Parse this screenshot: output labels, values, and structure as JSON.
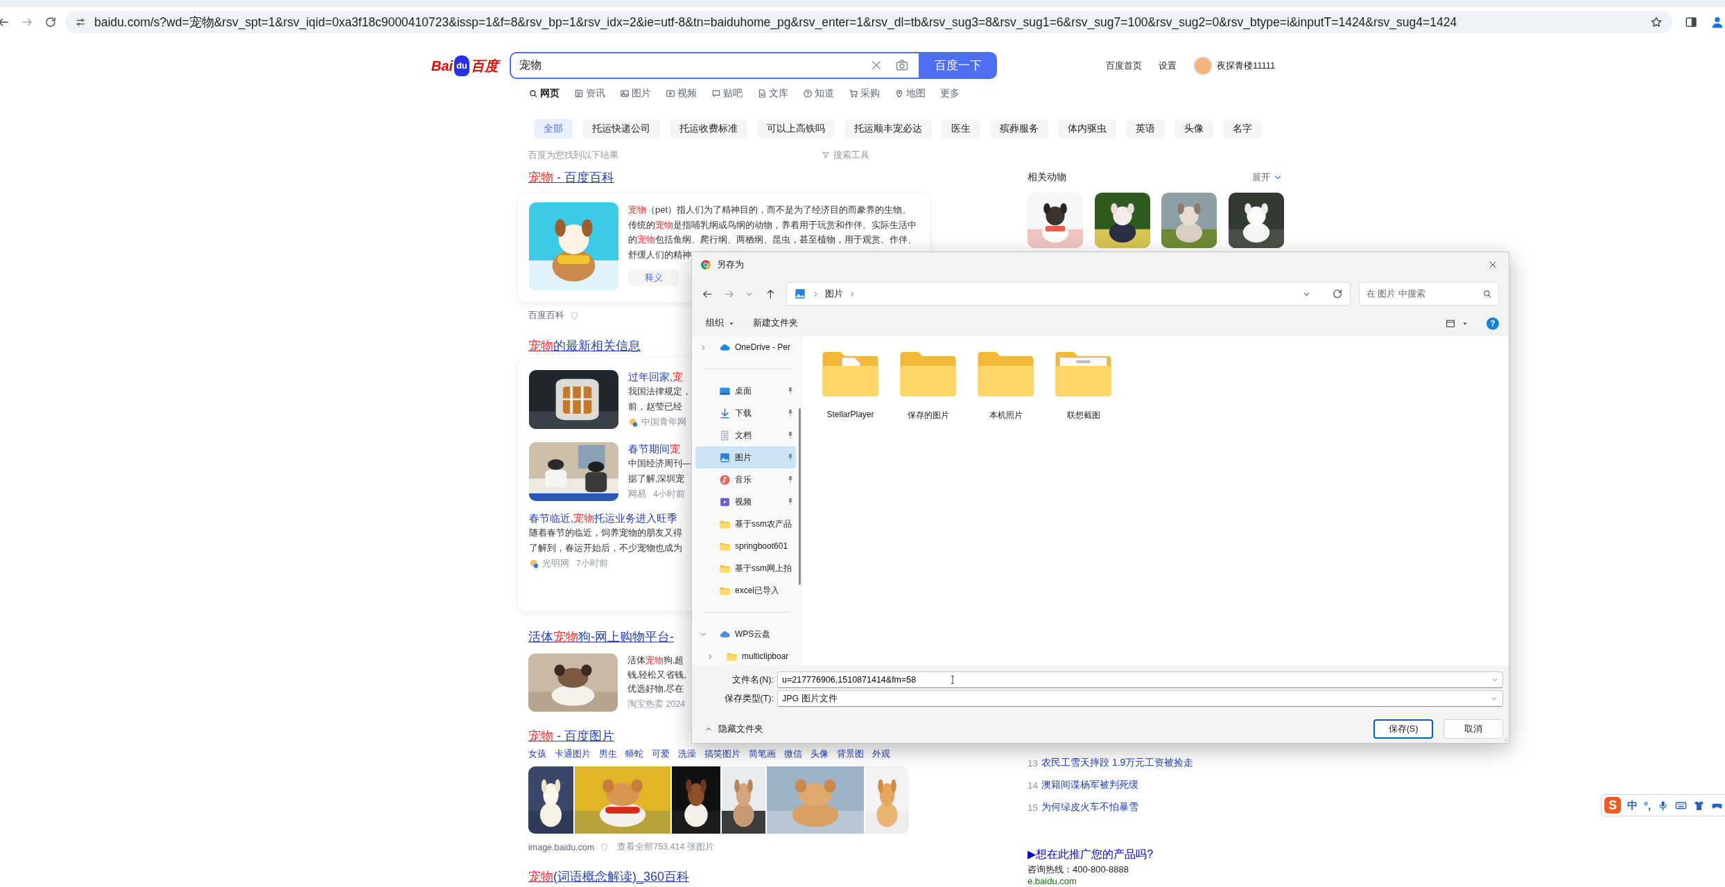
{
  "browser": {
    "url": "baidu.com/s?wd=宠物&rsv_spt=1&rsv_iqid=0xa3f18c9000410723&issp=1&f=8&rsv_bp=1&rsv_idx=2&ie=utf-8&tn=baiduhome_pg&rsv_enter=1&rsv_dl=tb&rsv_sug3=8&rsv_sug1=6&rsv_sug7=100&rsv_sug2=0&rsv_btype=i&inputT=1424&rsv_sug4=1424"
  },
  "header": {
    "logo": {
      "left": "Bai",
      "paw": "du",
      "right": "百度"
    },
    "search": {
      "value": "宠物"
    },
    "search_button": "百度一下",
    "links": [
      "百度首页",
      "设置"
    ],
    "user": "夜探青楼11111"
  },
  "tabs": [
    {
      "label": "网页",
      "selected": true
    },
    {
      "label": "资讯",
      "selected": false
    },
    {
      "label": "图片",
      "selected": false
    },
    {
      "label": "视频",
      "selected": false
    },
    {
      "label": "贴吧",
      "selected": false
    },
    {
      "label": "文库",
      "selected": false
    },
    {
      "label": "知道",
      "selected": false
    },
    {
      "label": "采购",
      "selected": false
    },
    {
      "label": "地图",
      "selected": false
    },
    {
      "label": "更多",
      "selected": false
    }
  ],
  "chips": [
    {
      "label": "全部",
      "selected": true
    },
    {
      "label": "托运快递公司",
      "selected": false
    },
    {
      "label": "托运收费标准",
      "selected": false
    },
    {
      "label": "可以上高铁吗",
      "selected": false
    },
    {
      "label": "托运顺丰宠必达",
      "selected": false
    },
    {
      "label": "医生",
      "selected": false
    },
    {
      "label": "殡葬服务",
      "selected": false
    },
    {
      "label": "体内驱虫",
      "selected": false
    },
    {
      "label": "英语",
      "selected": false
    },
    {
      "label": "头像",
      "selected": false
    },
    {
      "label": "名字",
      "selected": false
    }
  ],
  "result_count": "百度为您找到以下结果",
  "search_tools": "搜索工具",
  "results": [
    {
      "kind": "baike",
      "title": [
        {
          "t": "宠物",
          "hit": true
        },
        {
          "t": " - 百度百科",
          "hit": false
        }
      ],
      "lines": [
        [
          {
            "t": "宠物",
            "hit": true
          },
          {
            "t": "（pet）指人们为了精神目的，而不是为了经济目的而豢养的生物。",
            "hit": false
          }
        ],
        [
          {
            "t": "传统的",
            "hit": false
          },
          {
            "t": "宠物",
            "hit": true
          },
          {
            "t": "是指哺乳纲或鸟纲的动物，养着用于玩赏和作伴。实际生活中",
            "hit": false
          }
        ],
        [
          {
            "t": "的",
            "hit": false
          },
          {
            "t": "宠物",
            "hit": true
          },
          {
            "t": "包括鱼纲、爬行纲、两栖纲、昆虫，甚至植物，用于观赏、作伴、",
            "hit": false
          }
        ],
        [
          {
            "t": "舒缓人们的精神",
            "hit": false
          }
        ]
      ],
      "button": "释义",
      "source": "百度百科"
    },
    {
      "kind": "news",
      "title": [
        {
          "t": "宠物",
          "hit": true
        },
        {
          "t": "的最新相关信息",
          "hit": false
        }
      ],
      "items": [
        {
          "kind": "with_image",
          "title": [
            {
              "t": "过年回家,",
              "hit": false
            },
            {
              "t": "宠",
              "hit": true
            }
          ],
          "lines": [
            "我国法律规定，",
            "前，赵莹已经"
          ],
          "source": "中国青年网",
          "source_logo": true
        },
        {
          "kind": "with_image",
          "title": [
            {
              "t": "春节期间",
              "hit": false
            },
            {
              "t": "宠",
              "hit": true
            }
          ],
          "lines": [
            "中国经济周刊—",
            "据了解,深圳宠"
          ],
          "source": "网易",
          "time": "4小时前",
          "source_logo": false
        },
        {
          "kind": "text",
          "title": [
            {
              "t": "春节临近,",
              "hit": false
            },
            {
              "t": "宠物",
              "hit": true
            },
            {
              "t": "托运业务进入旺季",
              "hit": false
            }
          ],
          "lines": [
            "随着春节的临近，饲养宠物的朋友又得",
            "了解到，春运开始后，不少宠物也成为"
          ],
          "source": "光明网",
          "time": "7小时前",
          "source_logo": true
        }
      ]
    },
    {
      "kind": "shop",
      "title": [
        {
          "t": "活体",
          "hit": false
        },
        {
          "t": "宠物",
          "hit": true
        },
        {
          "t": "狗-网上购物平台-",
          "hit": false
        }
      ],
      "lines": [
        [
          {
            "t": "活体",
            "hit": false
          },
          {
            "t": "宠物",
            "hit": true
          },
          {
            "t": "狗,超",
            "hit": false
          }
        ],
        [
          {
            "t": "钱,轻松又省钱,",
            "hit": false
          }
        ],
        [
          {
            "t": "优选好物,尽在",
            "hit": false
          }
        ]
      ],
      "source": "淘宝热卖 2024"
    },
    {
      "kind": "images",
      "title": [
        {
          "t": "宠物",
          "hit": true
        },
        {
          "t": " - 百度图片",
          "hit": false
        }
      ],
      "tags": [
        "女孩",
        "卡通图片",
        "男生",
        "蟒蛇",
        "可爱",
        "洗澡",
        "搞笑图片",
        "简笔画",
        "微信",
        "头像",
        "背景图",
        "外观"
      ],
      "images": [
        {
          "kind": "picture"
        },
        {
          "kind": "picture"
        },
        {
          "kind": "picture"
        },
        {
          "kind": "picture"
        },
        {
          "kind": "picture"
        },
        {
          "kind": "picture"
        }
      ],
      "source": "image.baidu.com",
      "more": "查看全部753,414 张图片"
    },
    {
      "kind": "plain",
      "title": [
        {
          "t": "宠物",
          "hit": true
        },
        {
          "t": "(词语概念解读)_360百科",
          "hit": false
        }
      ]
    }
  ],
  "sidebar": {
    "related": {
      "title": "相关动物",
      "expand": "展开",
      "items": [
        {
          "kind": "picture"
        },
        {
          "kind": "picture"
        },
        {
          "kind": "picture"
        },
        {
          "kind": "picture"
        }
      ]
    },
    "hot": [
      {
        "rank": "13",
        "title": "农民工雪天摔跤 1.9万元工资被捡走"
      },
      {
        "rank": "14",
        "title": "澳籍间谍杨军被判死缓"
      },
      {
        "rank": "15",
        "title": "为何绿皮火车不怕暴雪"
      }
    ],
    "ad": {
      "title": "▶想在此推广您的产品吗?",
      "phone": "咨询热线：400-800-8888",
      "site": "e.baidu.com"
    }
  },
  "dialog": {
    "title": "另存为",
    "path": [
      "图片"
    ],
    "search_placeholder": "在 图片 中搜索",
    "toolbar": {
      "organize": "组织",
      "new_folder": "新建文件夹",
      "help": "?"
    },
    "nav_groups": [
      [
        {
          "label": "OneDrive - Per",
          "kind": "onedrive",
          "expanded": false,
          "selected": false
        }
      ],
      [
        {
          "label": "桌面",
          "kind": "desktop",
          "pinned": true,
          "selected": false
        },
        {
          "label": "下载",
          "kind": "downloads",
          "pinned": true,
          "selected": false
        },
        {
          "label": "文档",
          "kind": "documents",
          "pinned": true,
          "selected": false
        },
        {
          "label": "图片",
          "kind": "pictures",
          "pinned": true,
          "selected": true
        },
        {
          "label": "音乐",
          "kind": "music",
          "pinned": true,
          "selected": false
        },
        {
          "label": "视频",
          "kind": "videos",
          "pinned": true,
          "selected": false
        },
        {
          "label": "基于ssm农产品",
          "kind": "folder",
          "pinned": false,
          "selected": false
        },
        {
          "label": "springboot601",
          "kind": "folder",
          "pinned": false,
          "selected": false
        },
        {
          "label": "基于ssm网上拍",
          "kind": "folder",
          "pinned": false,
          "selected": false
        },
        {
          "label": "excel已导入",
          "kind": "folder",
          "pinned": false,
          "selected": false
        }
      ],
      [
        {
          "label": "WPS云盘",
          "kind": "wps",
          "expanded": true,
          "selected": false,
          "children": [
            {
              "label": "multiclipboar",
              "kind": "folder",
              "expanded": false,
              "selected": false
            }
          ]
        }
      ]
    ],
    "folders": [
      {
        "name": "StellarPlayer",
        "kind": "document"
      },
      {
        "name": "保存的图片",
        "kind": "plain"
      },
      {
        "name": "本机照片",
        "kind": "plain"
      },
      {
        "name": "联想截图",
        "kind": "screenshot"
      }
    ],
    "filename_label": "文件名(N):",
    "filename": "u=217776906,1510871414&fm=58",
    "type_label": "保存类型(T):",
    "type": "JPG 图片文件",
    "hide_folders": "隐藏文件夹",
    "buttons": [
      {
        "label": "保存(S)",
        "kind": "primary"
      },
      {
        "label": "取消",
        "kind": "secondary"
      }
    ]
  },
  "ime": {
    "logo": "S",
    "mode": "中",
    "punct": "°,"
  }
}
